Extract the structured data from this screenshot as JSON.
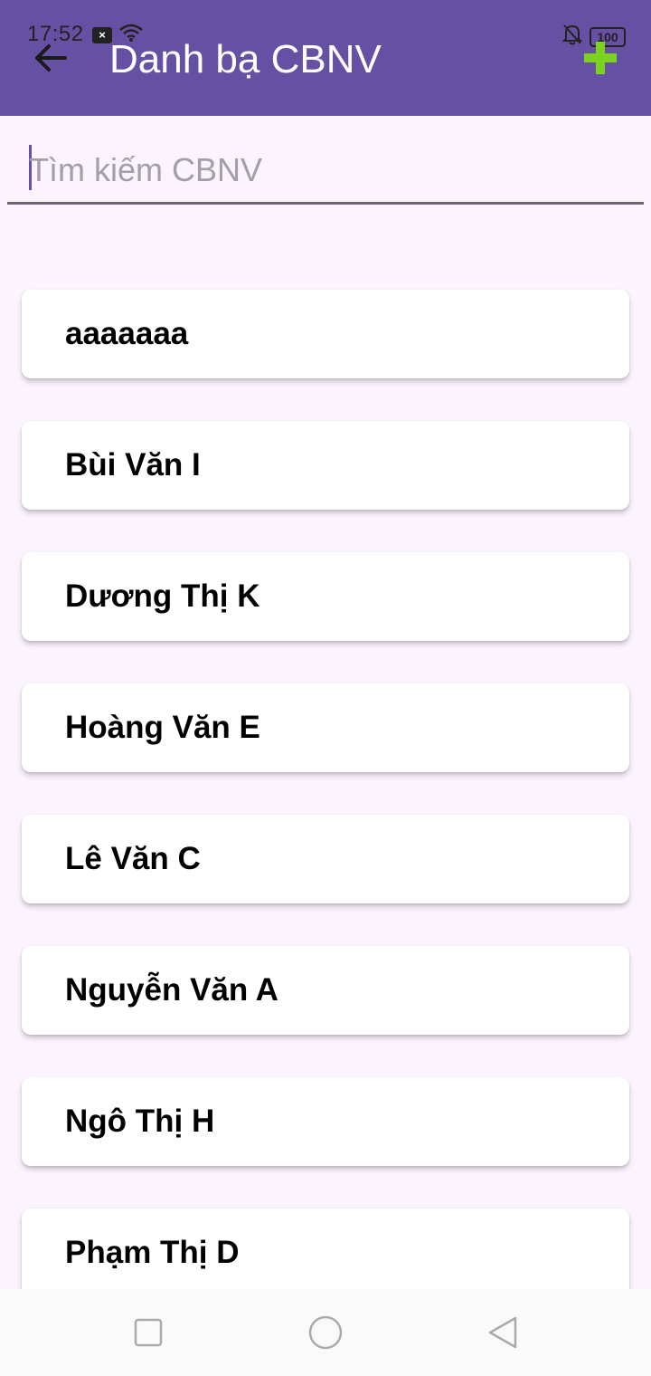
{
  "status_bar": {
    "time": "17:52",
    "battery": "100"
  },
  "header": {
    "title": "Danh bạ CBNV",
    "back_icon": "arrow-left-icon",
    "add_icon": "plus-icon",
    "add_icon_color": "#7cd11a"
  },
  "search": {
    "placeholder": "Tìm kiếm CBNV",
    "value": ""
  },
  "employees": [
    {
      "name": "aaaaaaa"
    },
    {
      "name": "Bùi Văn I"
    },
    {
      "name": "Dương Thị K"
    },
    {
      "name": "Hoàng Văn E"
    },
    {
      "name": "Lê Văn C"
    },
    {
      "name": "Nguyễn Văn A"
    },
    {
      "name": "Ngô Thị H"
    },
    {
      "name": "Phạm Thị D"
    }
  ],
  "colors": {
    "appbar": "#6650a4",
    "background": "#fbf3fd"
  },
  "navbar": {
    "icons": [
      "recent-apps-icon",
      "home-icon",
      "back-triangle-icon"
    ]
  }
}
